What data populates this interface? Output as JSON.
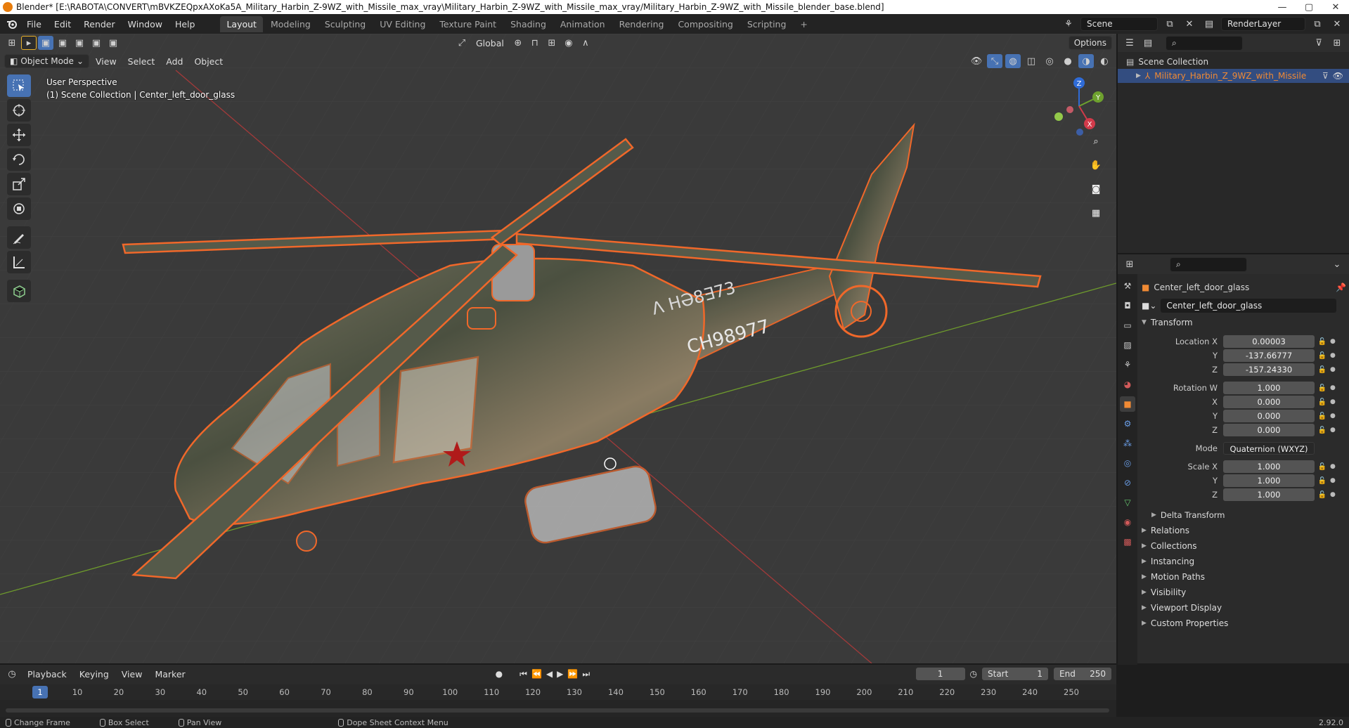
{
  "window": {
    "title": "Blender* [E:\\RABOTA\\CONVERT\\mBVKZEQpxAXoKa5A_Military_Harbin_Z-9WZ_with_Missile_max_vray\\Military_Harbin_Z-9WZ_with_Missile_max_vray/Military_Harbin_Z-9WZ_with_Missile_blender_base.blend]",
    "minimize": "—",
    "maximize": "▢",
    "close": "✕"
  },
  "menu": [
    "File",
    "Edit",
    "Render",
    "Window",
    "Help"
  ],
  "workspaces": [
    "Layout",
    "Modeling",
    "Sculpting",
    "UV Editing",
    "Texture Paint",
    "Shading",
    "Animation",
    "Rendering",
    "Compositing",
    "Scripting"
  ],
  "active_workspace": "Layout",
  "add_tab": "+",
  "scene_field": "Scene",
  "renderlayer_field": "RenderLayer",
  "viewport": {
    "orientation": "Global",
    "options": "Options",
    "mode": "Object Mode",
    "menus": [
      "View",
      "Select",
      "Add",
      "Object"
    ],
    "info_line1": "User Perspective",
    "info_line2": "(1) Scene Collection | Center_left_door_glass",
    "hull_text": "CH98977",
    "hull_text2": "Ʌ HƏ8∃73",
    "gizmo": {
      "z": "Z",
      "y": "Y",
      "x": "X"
    }
  },
  "outliner": {
    "root": "Scene Collection",
    "item": "Military_Harbin_Z_9WZ_with_Missile"
  },
  "properties": {
    "object_name": "Center_left_door_glass",
    "datablock": "Center_left_door_glass",
    "transform_title": "Transform",
    "location": {
      "label": "Location X",
      "x": "0.00003",
      "y": "-137.66777",
      "z": "-157.24330"
    },
    "rotation": {
      "label": "Rotation W",
      "w": "1.000",
      "x": "0.000",
      "y": "0.000",
      "z": "0.000"
    },
    "mode_label": "Mode",
    "mode_value": "Quaternion (WXYZ)",
    "scale": {
      "label": "Scale X",
      "x": "1.000",
      "y": "1.000",
      "z": "1.000"
    },
    "axis": {
      "x": "X",
      "y": "Y",
      "z": "Z"
    },
    "delta": "Delta Transform",
    "panels": [
      "Relations",
      "Collections",
      "Instancing",
      "Motion Paths",
      "Visibility",
      "Viewport Display",
      "Custom Properties"
    ]
  },
  "timeline": {
    "menus": [
      "Playback",
      "Keying",
      "View",
      "Marker"
    ],
    "current_frame": "1",
    "start_label": "Start",
    "start": "1",
    "end_label": "End",
    "end": "250",
    "ticks": [
      "1",
      "10",
      "20",
      "30",
      "40",
      "50",
      "60",
      "70",
      "80",
      "90",
      "100",
      "110",
      "120",
      "130",
      "140",
      "150",
      "160",
      "170",
      "180",
      "190",
      "200",
      "210",
      "220",
      "230",
      "240",
      "250"
    ]
  },
  "status": {
    "change_frame": "Change Frame",
    "box_select": "Box Select",
    "pan_view": "Pan View",
    "context_menu": "Dope Sheet Context Menu",
    "version": "2.92.0"
  },
  "colors": {
    "accent": "#4772b3",
    "selection": "#f0682a",
    "active_object": "#f08a34"
  }
}
